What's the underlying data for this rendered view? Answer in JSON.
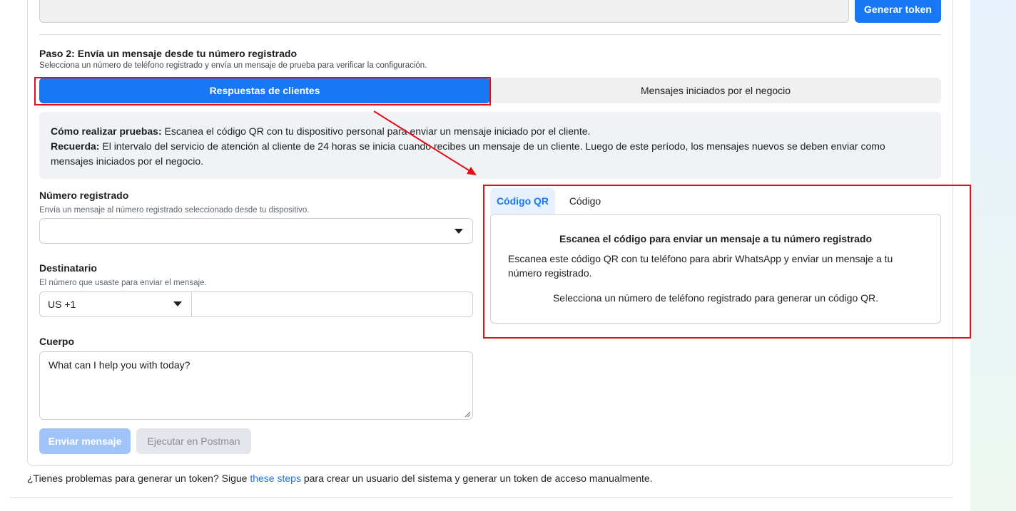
{
  "token": {
    "generate_label": "Generar token"
  },
  "step2": {
    "title": "Paso 2: Envía un mensaje desde tu número registrado",
    "subtitle": "Selecciona un número de teléfono registrado y envía un mensaje de prueba para verificar la configuración.",
    "tabs": [
      "Respuestas de clientes",
      "Mensajes iniciados por el negocio"
    ]
  },
  "info": {
    "line1_bold": "Cómo realizar pruebas:",
    "line1_text": " Escanea el código QR con tu dispositivo personal para enviar un mensaje iniciado por el cliente.",
    "line2_bold": "Recuerda:",
    "line2_text": " El intervalo del servicio de atención al cliente de 24 horas se inicia cuando recibes un mensaje de un cliente. Luego de este período, los mensajes nuevos se deben enviar como mensajes iniciados por el negocio."
  },
  "form": {
    "registered_label": "Número registrado",
    "registered_help": "Envía un mensaje al número registrado seleccionado desde tu dispositivo.",
    "registered_value": "",
    "recipient_label": "Destinatario",
    "recipient_help": "El número que usaste para enviar el mensaje.",
    "country_code": "US +1",
    "phone_value": "",
    "body_label": "Cuerpo",
    "body_value": "What can I help you with today?",
    "send_label": "Enviar mensaje",
    "postman_label": "Ejecutar en Postman"
  },
  "qr": {
    "tabs": [
      "Código QR",
      "Código"
    ],
    "title": "Escanea el código para enviar un mensaje a tu número registrado",
    "description": "Escanea este código QR con tu teléfono para abrir WhatsApp y enviar un mensaje a tu número registrado.",
    "hint": "Selecciona un número de teléfono registrado para generar un código QR."
  },
  "footer": {
    "before": "¿Tienes problemas para generar un token? Sigue ",
    "link": "these steps",
    "after": " para crear un usuario del sistema y generar un token de acceso manualmente."
  },
  "colors": {
    "accent": "#1877f2",
    "annotation_red": "#e0101b",
    "disabled_button": "#a0c4f8"
  }
}
